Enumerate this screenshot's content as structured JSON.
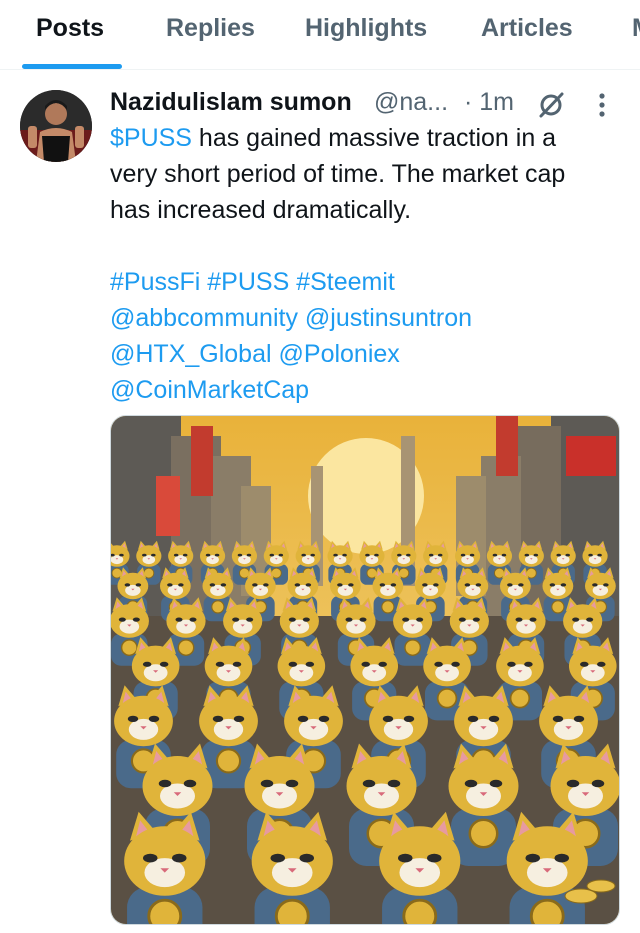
{
  "tabs": [
    {
      "label": "Posts",
      "active": true
    },
    {
      "label": "Replies"
    },
    {
      "label": "Highlights"
    },
    {
      "label": "Articles"
    },
    {
      "label": "M"
    }
  ],
  "post": {
    "author_name": "Nazidulislam sumon",
    "handle": "@na...",
    "time": "· 1m",
    "text": {
      "cashtag": "$PUSS",
      "line1_rest": " has gained massive traction in a",
      "line2": "very short period of time. The market cap",
      "line3": "has increased dramatically."
    },
    "hashtags": {
      "h1": "#PussFi",
      "h2": "#PUSS",
      "h3": "#Steemit"
    },
    "mentions": {
      "m1": "@abbcommunity",
      "m2": "@justinsuntron",
      "m3": "@HTX_Global",
      "m4": "@Poloniex",
      "m5": "@CoinMarketCap"
    }
  },
  "icons": {
    "grok": "grok-icon",
    "more": "more-vertical-icon"
  },
  "colors": {
    "link": "#1d9bf0",
    "text": "#0f1419",
    "muted": "#536471",
    "gold": "#e0b43a",
    "armor": "#4a6a8a"
  }
}
